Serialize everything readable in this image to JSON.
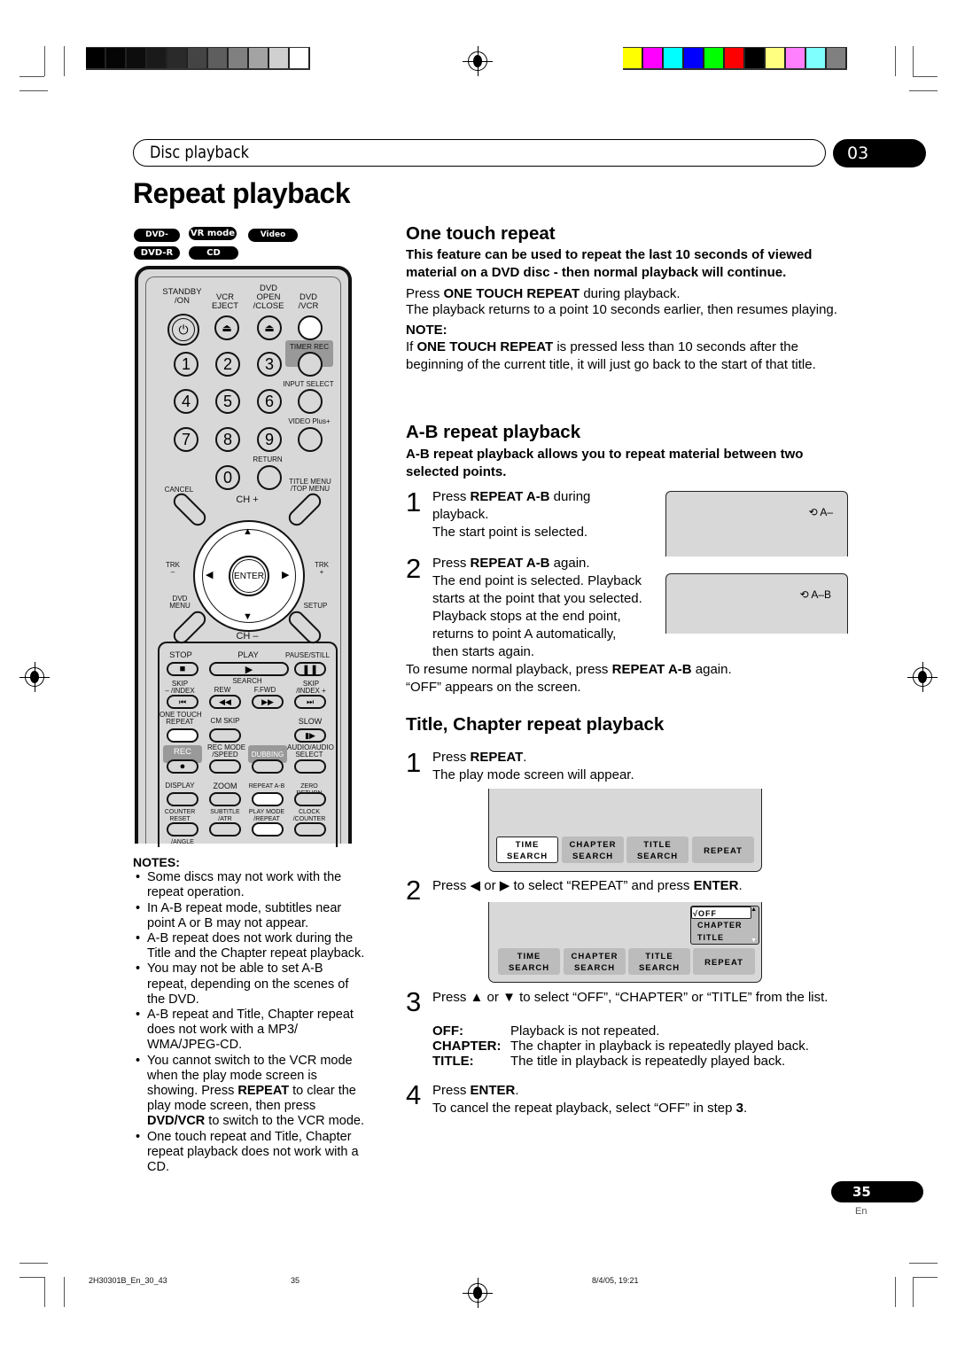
{
  "print_marks": {
    "gray_bars": [
      "#000000",
      "#050505",
      "#0d0d0d",
      "#1a1a1a",
      "#2a2a2a",
      "#444444",
      "#5e5e5e",
      "#808080",
      "#a3a3a3",
      "#d0d0d0",
      "#ffffff"
    ],
    "color_bars": [
      "#ffff00",
      "#ff00ff",
      "#00ffff",
      "#0000ff",
      "#00ff00",
      "#ff0000",
      "#000000",
      "#ffff80",
      "#ff80ff",
      "#80ffff",
      "#808080"
    ]
  },
  "header": {
    "section": "Disc playback",
    "chapter": "03",
    "title": "Repeat playback"
  },
  "badges": [
    "DVD-Video",
    "VR mode",
    "Video mode",
    "DVD-R",
    "CD"
  ],
  "remote": {
    "top_labels": [
      "STANDBY\n/ON",
      "VCR\nEJECT",
      "DVD\nOPEN\n/CLOSE",
      "DVD\n/VCR"
    ],
    "timer_rec": "TIMER REC",
    "input_select": "INPUT SELECT",
    "video_plus": "VIDEO Plus+",
    "return": "RETURN",
    "cancel": "CANCEL",
    "title_menu": "TITLE MENU\n/TOP MENU",
    "ch_plus": "CH +",
    "ch_minus": "CH –",
    "trk_minus": "TRK\n–",
    "trk_plus": "TRK\n+",
    "dvd_menu": "DVD\nMENU",
    "setup": "SETUP",
    "enter": "ENTER",
    "digits": [
      "1",
      "2",
      "3",
      "4",
      "5",
      "6",
      "7",
      "8",
      "9",
      "0"
    ],
    "stop": "STOP",
    "play": "PLAY",
    "pause": "PAUSE/STILL",
    "skip_minus": "SKIP\n– /INDEX",
    "search": "SEARCH",
    "rew": "REW",
    "ffwd": "F.FWD",
    "skip_plus": "SKIP\n/INDEX +",
    "one_touch": "ONE TOUCH\nREPEAT",
    "cm_skip": "CM SKIP",
    "slow": "SLOW",
    "rec": "REC",
    "rec_mode": "REC MODE\n/SPEED",
    "dubbing": "DUBBING",
    "audio": "AUDIO/AUDIO\nSELECT",
    "display": "DISPLAY",
    "zoom": "ZOOM",
    "repeat_ab": "REPEAT A-B",
    "zero_return": "ZERO RETURN",
    "counter_reset": "COUNTER\nRESET",
    "subtitle": "SUBTITLE\n/ATR",
    "play_mode": "PLAY MODE\n/REPEAT",
    "clock": "CLOCK\n/COUNTER",
    "angle": "/ANGLE"
  },
  "notes": {
    "heading": "NOTES:",
    "items": [
      {
        "text": "Some discs may not work with the repeat operation."
      },
      {
        "text": "In A-B repeat mode, subtitles near point A or B may not appear."
      },
      {
        "text": "A-B repeat does not work during the Title and the Chapter repeat playback."
      },
      {
        "text": "You may not be able to set A-B repeat, depending on the scenes of the DVD."
      },
      {
        "text": "A-B repeat and Title, Chapter repeat does not work with a MP3/ WMA/JPEG-CD."
      },
      {
        "pre": "You cannot switch to the VCR mode when the play mode screen is showing. Press ",
        "b1": "REPEAT",
        "mid": " to clear the play mode screen, then press ",
        "b2": "DVD/VCR",
        "post": " to switch to the VCR mode."
      },
      {
        "text": "One touch repeat and Title, Chapter repeat playback does not work with a CD."
      }
    ]
  },
  "one_touch": {
    "heading": "One touch repeat",
    "lead": "This feature can be used to repeat the last 10 seconds of viewed material on a DVD disc - then normal playback will continue.",
    "p1_pre": "Press ",
    "p1_b": "ONE TOUCH REPEAT",
    "p1_post": " during playback.",
    "p2": "The playback returns to a point 10 seconds earlier, then resumes playing.",
    "note_heading": "NOTE:",
    "note_pre": "If ",
    "note_b": "ONE TOUCH REPEAT",
    "note_post": " is pressed less than 10 seconds after the beginning of the current title, it will just go back to the start of that title."
  },
  "ab_repeat": {
    "heading": "A-B repeat playback",
    "lead": "A-B repeat playback allows you to repeat material between two selected points.",
    "step1": {
      "num": "1",
      "pre": "Press ",
      "b": "REPEAT A-B",
      "post": " during playback.",
      "sub": "The start point is selected."
    },
    "step2": {
      "num": "2",
      "pre": "Press ",
      "b": "REPEAT A-B",
      "post": " again.",
      "sub": "The end point is selected. Playback starts at the point that you selected. Playback stops at the end point, returns to point A automatically, then starts again."
    },
    "screen1_osd": "A–",
    "screen2_osd": "A–B",
    "resume_pre": "To resume normal playback, press ",
    "resume_b": "REPEAT A-B",
    "resume_post": " again.",
    "off_text": "“OFF” appears on the screen."
  },
  "title_chapter": {
    "heading": "Title, Chapter repeat playback",
    "step1": {
      "num": "1",
      "pre": "Press ",
      "b": "REPEAT",
      "post": ".",
      "sub": "The play mode screen will appear."
    },
    "step2": {
      "num": "2",
      "pre": "Press ",
      "arrow1": "◀",
      "or": " or ",
      "arrow2": "▶",
      "mid": " to select “REPEAT” and press ",
      "b": "ENTER",
      "post": "."
    },
    "step3": {
      "num": "3",
      "pre": "Press ",
      "arrow1": "▲",
      "or": " or ",
      "arrow2": "▼",
      "post": " to select “OFF”, “CHAPTER” or “TITLE” from the list."
    },
    "definitions": [
      {
        "key": "OFF:",
        "value": "Playback is not repeated."
      },
      {
        "key": "CHAPTER:",
        "value": "The chapter in playback is repeatedly played back."
      },
      {
        "key": "TITLE:",
        "value": "The title in playback is repeatedly played back."
      }
    ],
    "step4": {
      "num": "4",
      "pre": "Press ",
      "b": "ENTER",
      "post": ".",
      "sub_pre": "To cancel the repeat playback, select “OFF” in step ",
      "sub_b": "3",
      "sub_post": "."
    },
    "play_mode_buttons": [
      {
        "l1": "TIME",
        "l2": "SEARCH"
      },
      {
        "l1": "CHAPTER",
        "l2": "SEARCH"
      },
      {
        "l1": "TITLE",
        "l2": "SEARCH"
      },
      {
        "l1": "REPEAT",
        "l2": ""
      }
    ],
    "repeat_options": [
      "√OFF",
      "CHAPTER",
      "TITLE"
    ]
  },
  "footer": {
    "page_number": "35",
    "language": "En",
    "file": "2H30301B_En_30_43",
    "print_page": "35",
    "timestamp": "8/4/05, 19:21"
  }
}
